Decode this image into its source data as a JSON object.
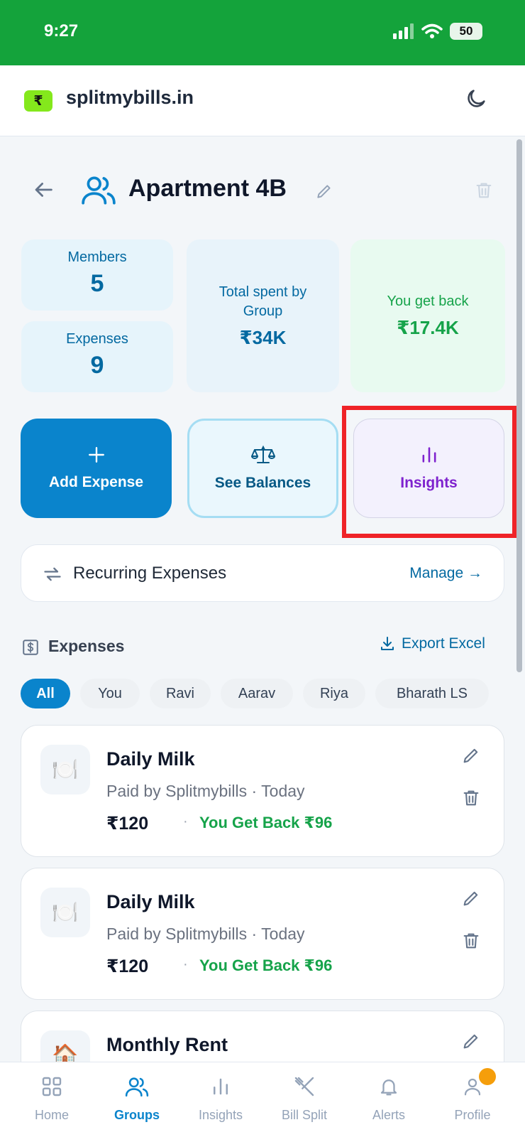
{
  "status": {
    "time": "9:27",
    "battery": "50"
  },
  "header": {
    "site_name": "splitmybills.in",
    "logo_symbol": "₹"
  },
  "group": {
    "name": "Apartment 4B"
  },
  "stats": {
    "members_label": "Members",
    "members_value": "5",
    "expenses_label": "Expenses",
    "expenses_value": "9",
    "total_label": "Total spent by Group",
    "total_value": "₹34K",
    "get_back_label": "You get back",
    "get_back_value": "₹17.4K"
  },
  "actions": {
    "add_label": "Add Expense",
    "balances_label": "See Balances",
    "insights_label": "Insights"
  },
  "recurring": {
    "label": "Recurring Expenses",
    "manage_label": "Manage →"
  },
  "expenses_section": {
    "title": "Expenses",
    "export_label": "Export Excel"
  },
  "filters": [
    "All",
    "You",
    "Ravi",
    "Aarav",
    "Riya",
    "Bharath LS"
  ],
  "expenses": [
    {
      "title": "Daily Milk",
      "subtitle": "Paid by Splitmybills · Today",
      "amount": "₹120",
      "status": "You Get Back ₹96",
      "icon": "🍽️"
    },
    {
      "title": "Daily Milk",
      "subtitle": "Paid by Splitmybills · Today",
      "amount": "₹120",
      "status": "You Get Back ₹96",
      "icon": "🍽️"
    },
    {
      "title": "Monthly Rent",
      "icon": "🏠"
    }
  ],
  "nav": {
    "home": "Home",
    "groups": "Groups",
    "insights": "Insights",
    "bill_split": "Bill Split",
    "alerts": "Alerts",
    "profile": "Profile"
  },
  "colors": {
    "status_bar": "#14a33b",
    "accent": "#0a84cc",
    "positive": "#16a34a",
    "insights": "#7e22ce",
    "highlight": "#ef2328"
  }
}
